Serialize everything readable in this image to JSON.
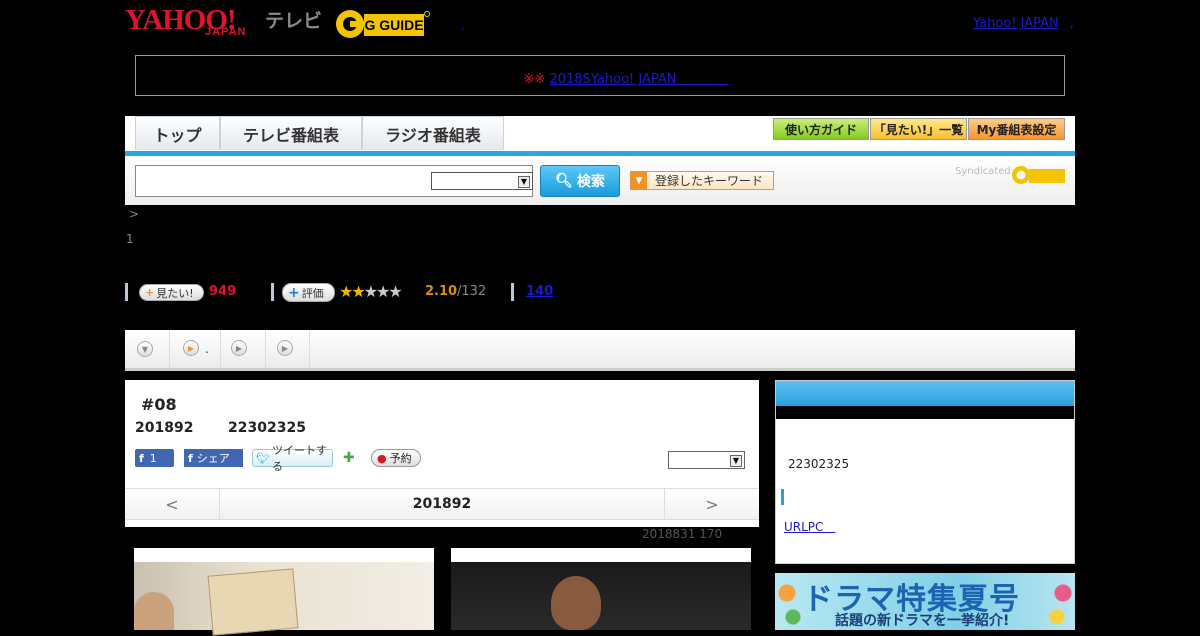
{
  "header": {
    "yahoo_logo": "YAHOO!",
    "japan_logo": "JAPAN",
    "tv_logo": "テレビ",
    "gguide_logo": "G GUIDE",
    "yahoo_japan_link": "Yahoo! JAPAN",
    "dot_1": ",",
    "dot_2": ","
  },
  "notice": {
    "marks": "※※",
    "link": "2018SYahoo! JAPAN　　　　"
  },
  "nav": {
    "tabs": [
      "トップ",
      "テレビ番組表",
      "ラジオ番組表"
    ],
    "tools": [
      "使い方ガイド",
      "「見たい!」一覧",
      "My番組表設定"
    ],
    "search_button": "検索",
    "keyword_button": "登録したキーワード",
    "syndicated": "Syndicated"
  },
  "breadcrumb": ">",
  "episode_count": "1",
  "stats": {
    "want_label": "見たい!",
    "want_count": "949",
    "rate_label": "評価",
    "stars": "★★★★★",
    "rating_value": "2.10",
    "rating_total": "/132",
    "review_count": "140"
  },
  "tabs_strip": {
    "tab2_suffix": "."
  },
  "episode": {
    "number": "#08",
    "date": "201892",
    "time": "22302325",
    "fb_like_count": "1",
    "fb_share": "シェア",
    "tweet": "ツイートする",
    "reserve": "予約",
    "nav_date": "201892",
    "prev": "<",
    "next": ">",
    "update_note": "2018831  170"
  },
  "side": {
    "time": "22302325",
    "link": "URLPC　"
  },
  "banner": {
    "title": "ドラマ特集夏号",
    "subtitle": "話題の新ドラマを一挙紹介!"
  }
}
